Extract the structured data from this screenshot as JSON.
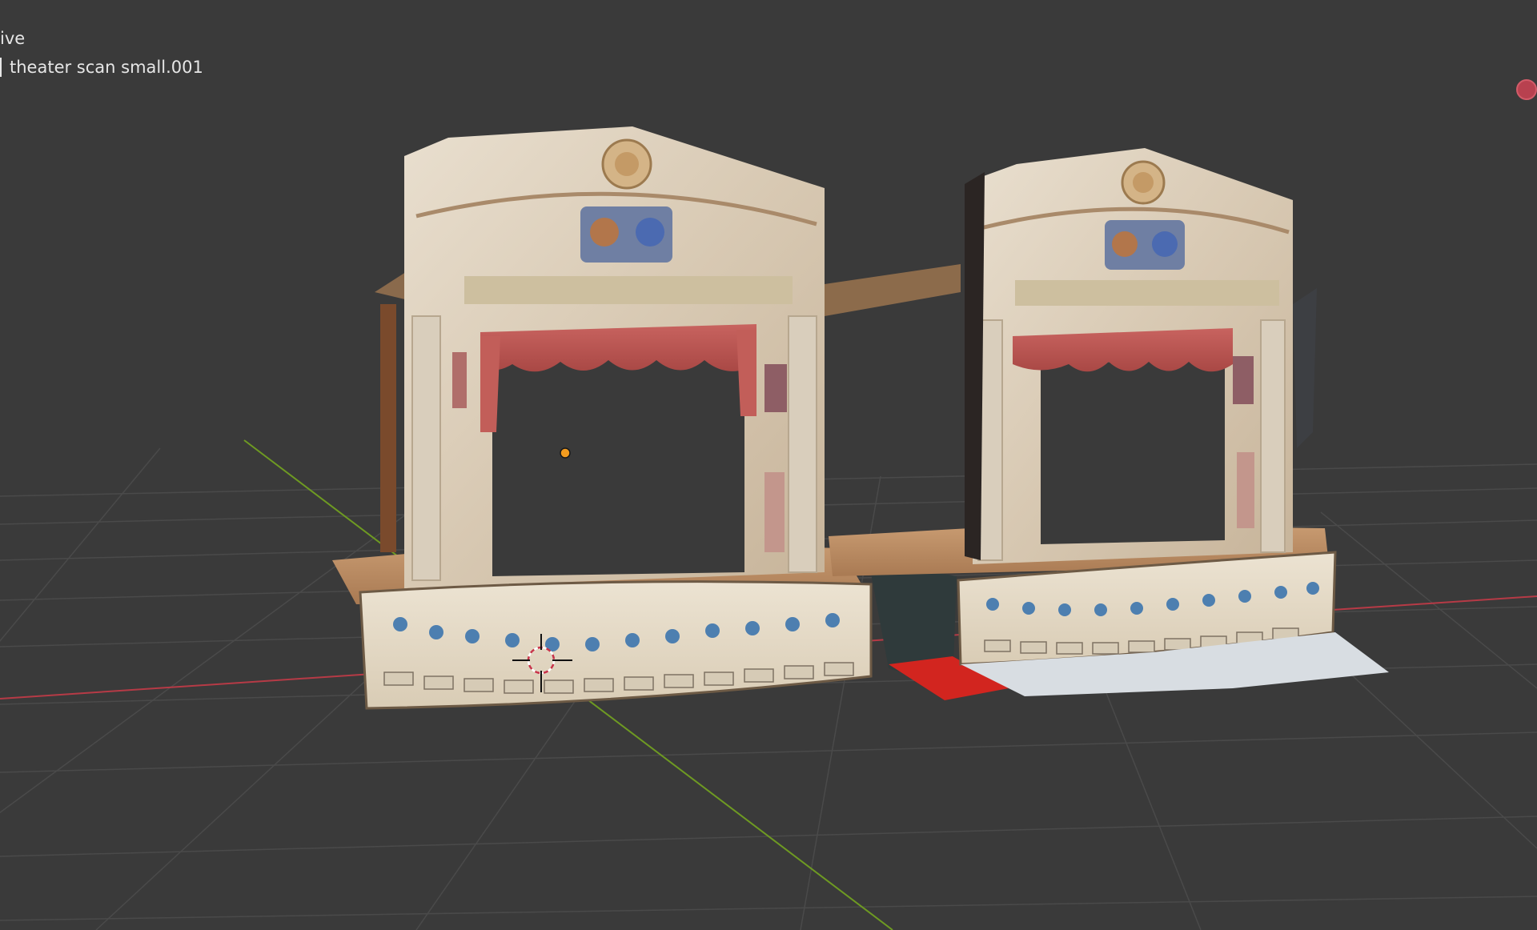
{
  "viewport": {
    "mode_label": "ive",
    "object_name": "theater scan small.001"
  },
  "colors": {
    "background": "#3a3a3a",
    "grid": "#4a4a4a",
    "x_axis": "#b63a46",
    "y_axis": "#6e9a22",
    "origin_point": "#f39c1f",
    "record_indicator": "#b8414f"
  },
  "icons": {
    "origin": "origin-point-icon",
    "cursor": "3d-cursor-icon",
    "record": "record-dot-icon"
  }
}
